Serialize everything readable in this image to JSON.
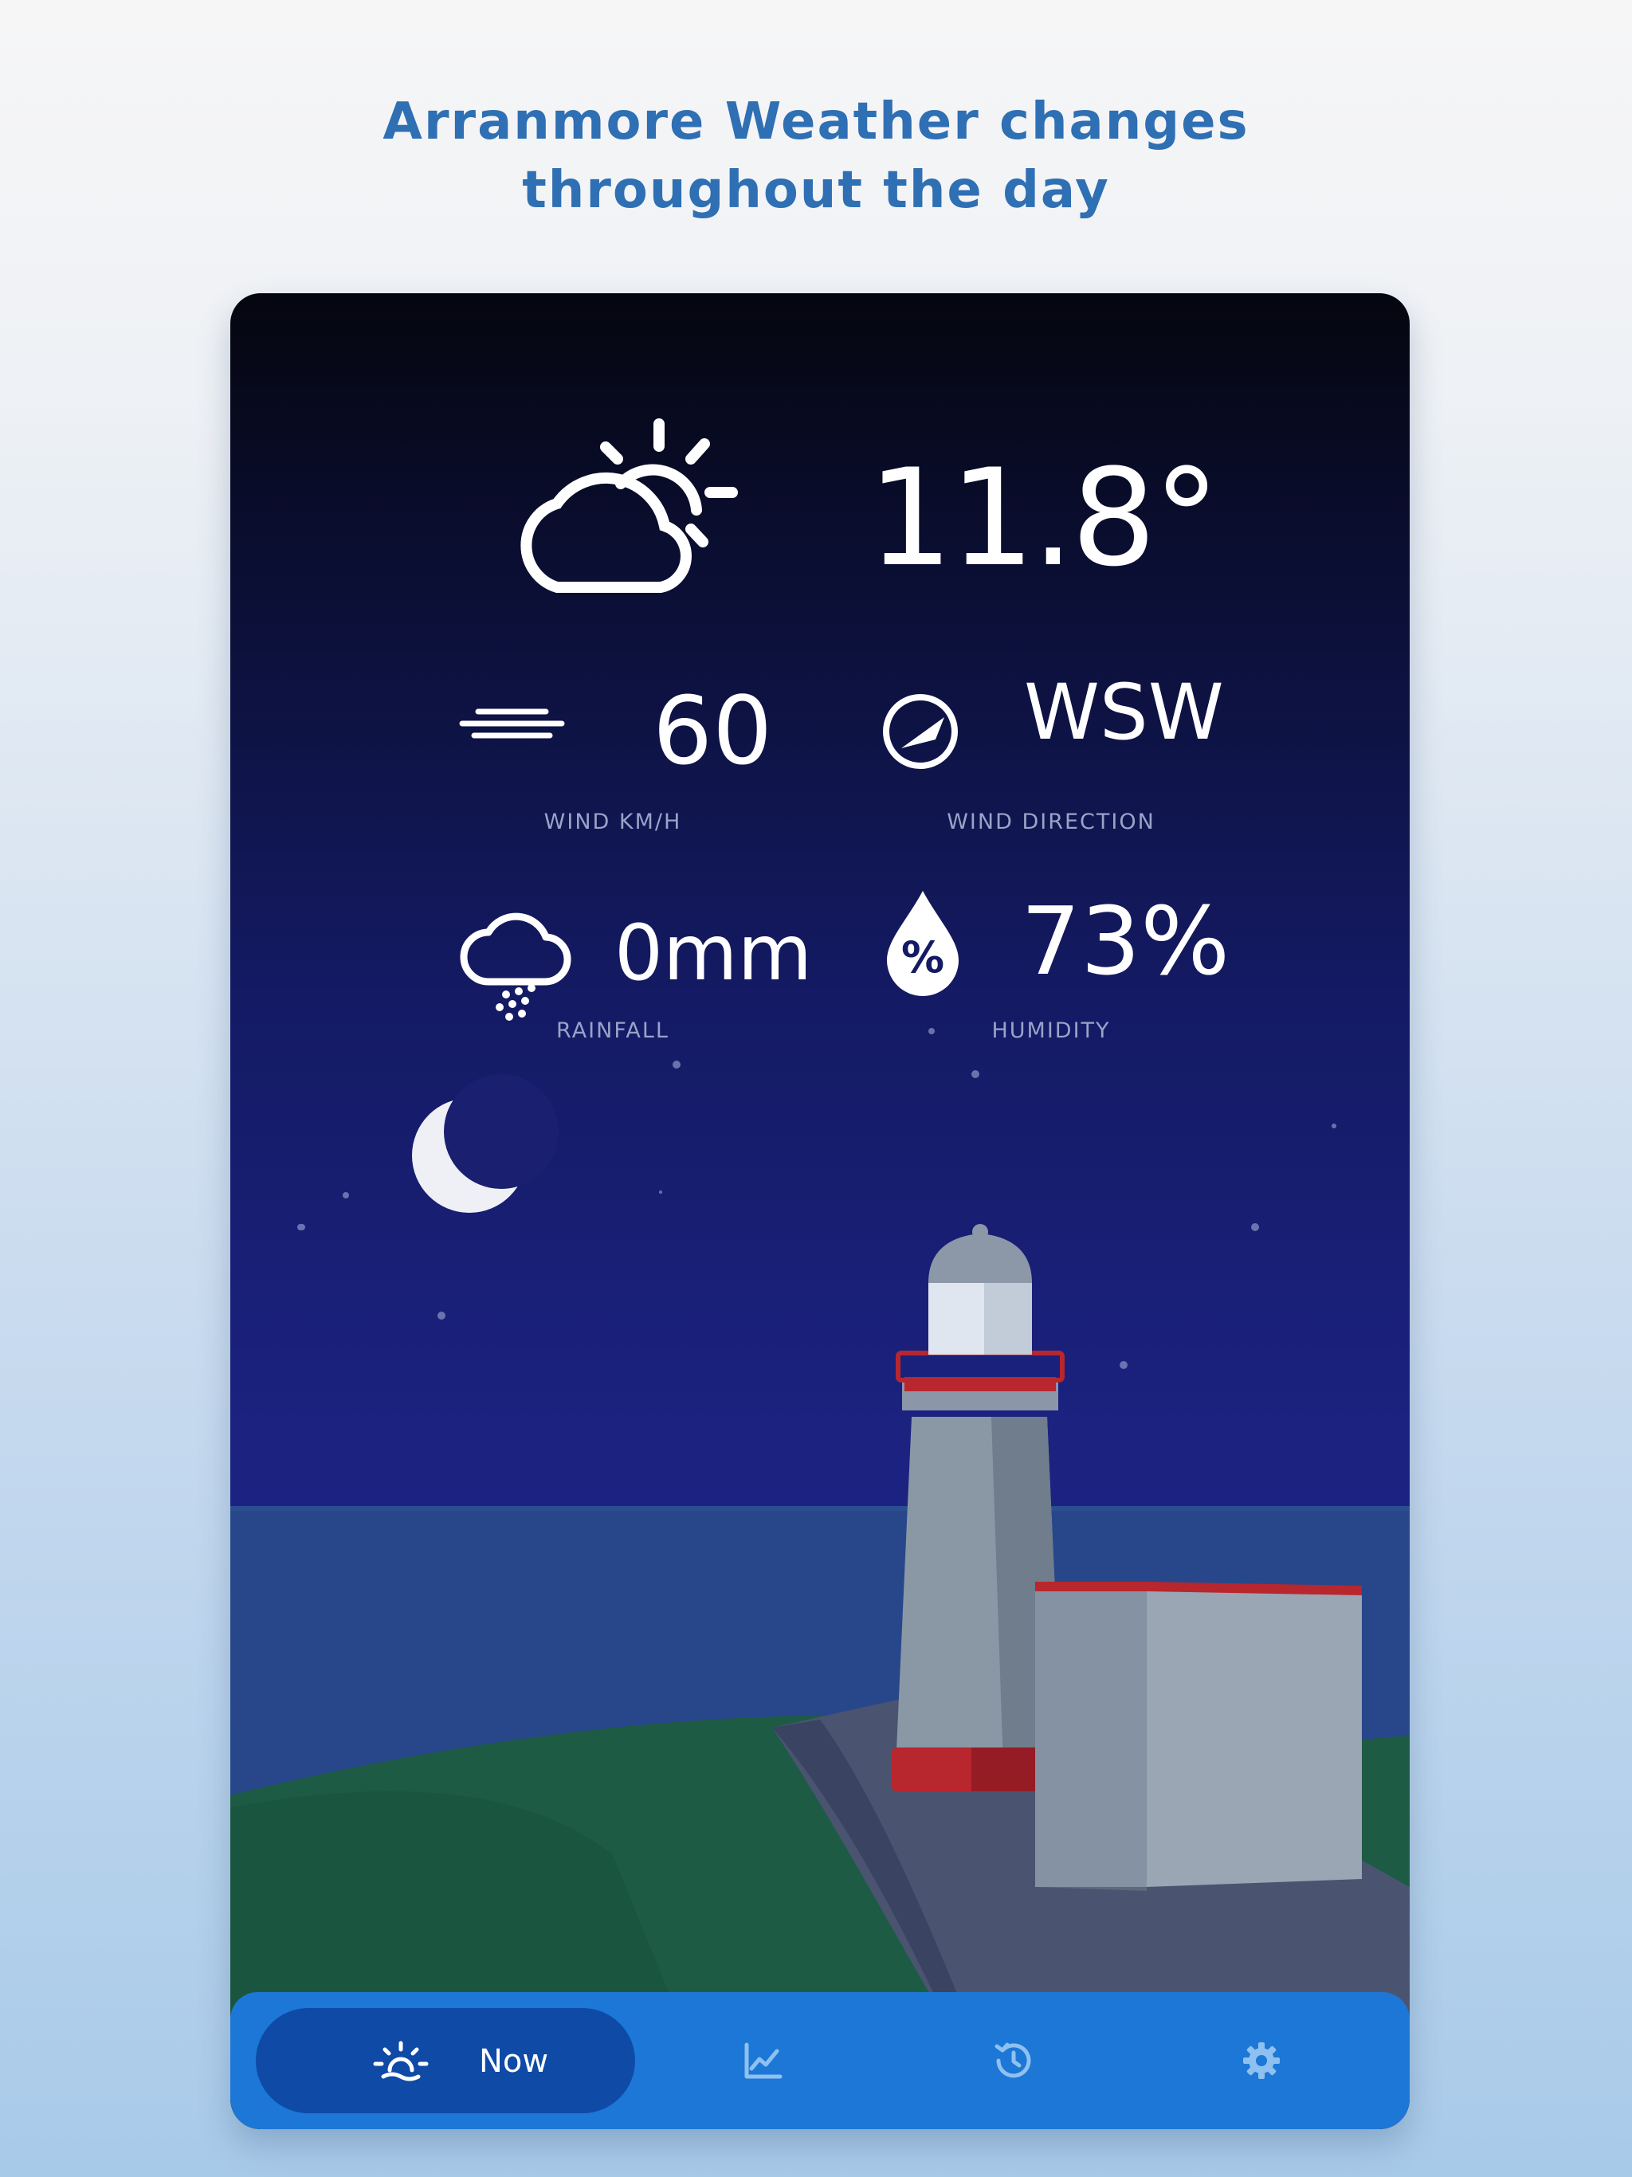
{
  "headline": {
    "line1": "Arranmore Weather changes",
    "line2": "throughout the day"
  },
  "weather": {
    "condition_icon": "partly-cloudy-sun-icon",
    "temperature": "11.8°",
    "wind_speed": {
      "value": "60",
      "label": "WIND KM/H",
      "icon": "wind-icon"
    },
    "wind_direction": {
      "value": "WSW",
      "label": "WIND DIRECTION",
      "icon": "compass-icon"
    },
    "rainfall": {
      "value": "0mm",
      "label": "RAINFALL",
      "icon": "rain-cloud-icon"
    },
    "humidity": {
      "value": "73%",
      "label": "HUMIDITY",
      "icon": "humidity-drop-icon"
    }
  },
  "nav": {
    "items": [
      {
        "label": "Now",
        "icon": "sunrise-icon",
        "active": true
      },
      {
        "label": "",
        "icon": "chart-icon",
        "active": false
      },
      {
        "label": "",
        "icon": "history-icon",
        "active": false
      },
      {
        "label": "",
        "icon": "settings-gear-icon",
        "active": false
      }
    ]
  },
  "colors": {
    "headline": "#2f6fb3",
    "nav_bar": "#1c77d6",
    "nav_active": "#0e4aa6",
    "sky_top": "#05060f",
    "sky_bottom": "#1c2488",
    "sea": "#28478a",
    "grass": "#1d5b45",
    "lighthouse_red": "#b8262e"
  }
}
